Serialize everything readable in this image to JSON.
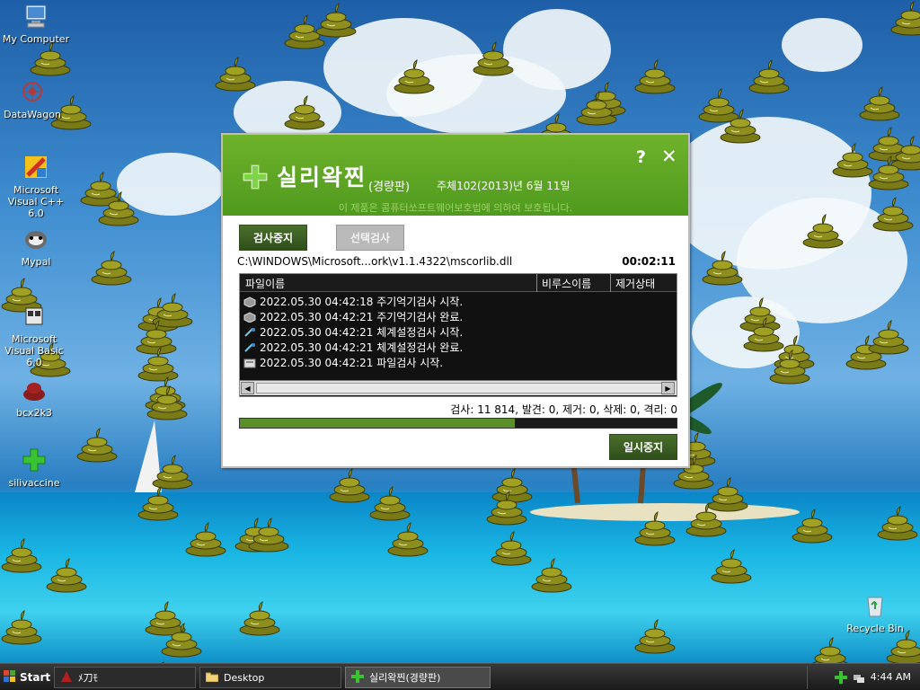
{
  "desktop": {
    "icons": [
      {
        "label": "My Computer"
      },
      {
        "label": "DataWagon"
      },
      {
        "label": "Microsoft Visual C++ 6.0"
      },
      {
        "label": "Mypal"
      },
      {
        "label": "Microsoft Visual Basic 6.0"
      },
      {
        "label": "bcx2k3"
      },
      {
        "label": "silivaccine"
      },
      {
        "label": "Recycle Bin"
      }
    ]
  },
  "dialog": {
    "title": "실리왁찐",
    "edition": "(경량판)",
    "date": "주체102(2013)년 6월 11일",
    "copyright": "이 제품은 콤퓨터쏘프트웨어보호법에 의하여 보호됩니다.",
    "help_label": "?",
    "close_label": "✕",
    "stop_button": "검사중지",
    "select_button": "선택검사",
    "current_path": "C:\\WINDOWS\\Microsoft...ork\\v1.1.4322\\mscorlib.dll",
    "timer": "00:02:11",
    "log": {
      "columns": [
        "파일이름",
        "비루스이름",
        "제거상태"
      ],
      "rows": [
        {
          "text": "2022.05.30 04:42:18 주기억기검사 시작.",
          "icon": "memory-icon"
        },
        {
          "text": "2022.05.30 04:42:21 주기억기검사 완료.",
          "icon": "memory-icon"
        },
        {
          "text": "2022.05.30 04:42:21 체계설정검사 시작.",
          "icon": "settings-icon"
        },
        {
          "text": "2022.05.30 04:42:21 체계설정검사 완료.",
          "icon": "settings-icon"
        },
        {
          "text": "2022.05.30 04:42:21 파일검사 시작.",
          "icon": "file-icon"
        }
      ]
    },
    "stats": "검사: 11 814, 발견: 0, 제거: 0, 삭제: 0, 격리: 0",
    "progress": 0.63,
    "pause_button": "일시중지"
  },
  "taskbar": {
    "start_label": "Start",
    "tasks": [
      {
        "label": "ﾒ刀ﾓ"
      },
      {
        "label": "Desktop"
      },
      {
        "label": "실리왁찐(경량판)"
      }
    ],
    "clock": "4:44 AM"
  },
  "colors": {
    "brand_green": "#5aa524",
    "button_dark_green": "#3d5e22",
    "progress_green": "#5a8f2a"
  }
}
